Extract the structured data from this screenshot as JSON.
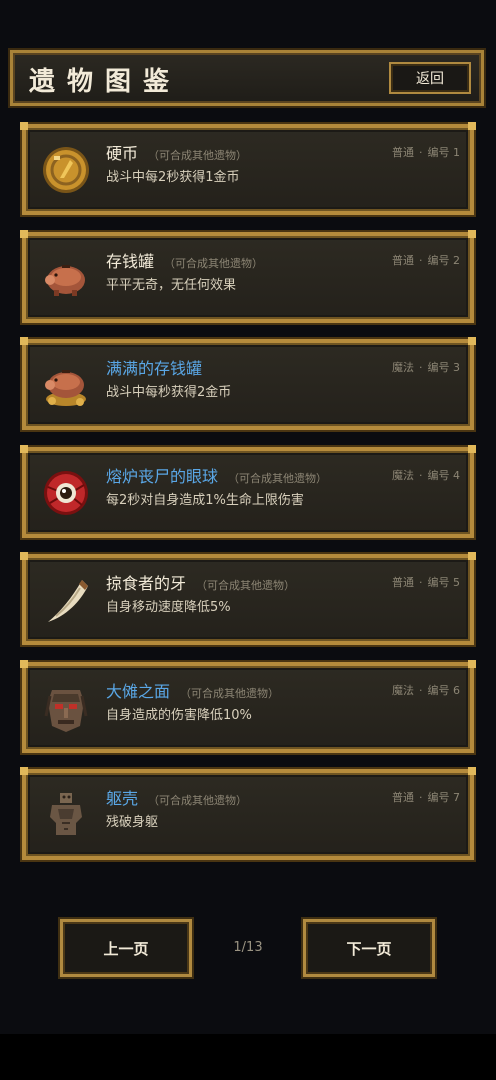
{
  "header": {
    "title": "遗物图鉴",
    "back_label": "返回"
  },
  "items": [
    {
      "name": "硬币",
      "note": "（可合成其他遗物）",
      "desc": "战斗中每2秒获得1金币",
      "rarity": "普通",
      "code_label": "编号",
      "code": "1",
      "magic": false,
      "icon": "coin-icon"
    },
    {
      "name": "存钱罐",
      "note": "（可合成其他遗物）",
      "desc": "平平无奇，无任何效果",
      "rarity": "普通",
      "code_label": "编号",
      "code": "2",
      "magic": false,
      "icon": "piggy-bank-icon"
    },
    {
      "name": "满满的存钱罐",
      "note": "",
      "desc": "战斗中每秒获得2金币",
      "rarity": "魔法",
      "code_label": "编号",
      "code": "3",
      "magic": true,
      "icon": "full-piggy-bank-icon"
    },
    {
      "name": "熔炉丧尸的眼球",
      "note": "（可合成其他遗物）",
      "desc": "每2秒对自身造成1%生命上限伤害",
      "rarity": "魔法",
      "code_label": "编号",
      "code": "4",
      "magic": true,
      "icon": "eyeball-icon"
    },
    {
      "name": "掠食者的牙",
      "note": "（可合成其他遗物）",
      "desc": "自身移动速度降低5%",
      "rarity": "普通",
      "code_label": "编号",
      "code": "5",
      "magic": false,
      "icon": "fang-icon"
    },
    {
      "name": "大傩之面",
      "note": "（可合成其他遗物）",
      "desc": "自身造成的伤害降低10%",
      "rarity": "魔法",
      "code_label": "编号",
      "code": "6",
      "magic": true,
      "icon": "mask-icon"
    },
    {
      "name": "躯壳",
      "note": "（可合成其他遗物）",
      "desc": "残破身躯",
      "rarity": "普通",
      "code_label": "编号",
      "code": "7",
      "magic": false,
      "icon": "husk-icon"
    }
  ],
  "pager": {
    "prev_label": "上一页",
    "next_label": "下一页",
    "page": "1/13"
  },
  "colors": {
    "gold_border": "#b58b3c",
    "magic_name": "#5aa7e6",
    "panel_bg": "#2a271f"
  }
}
